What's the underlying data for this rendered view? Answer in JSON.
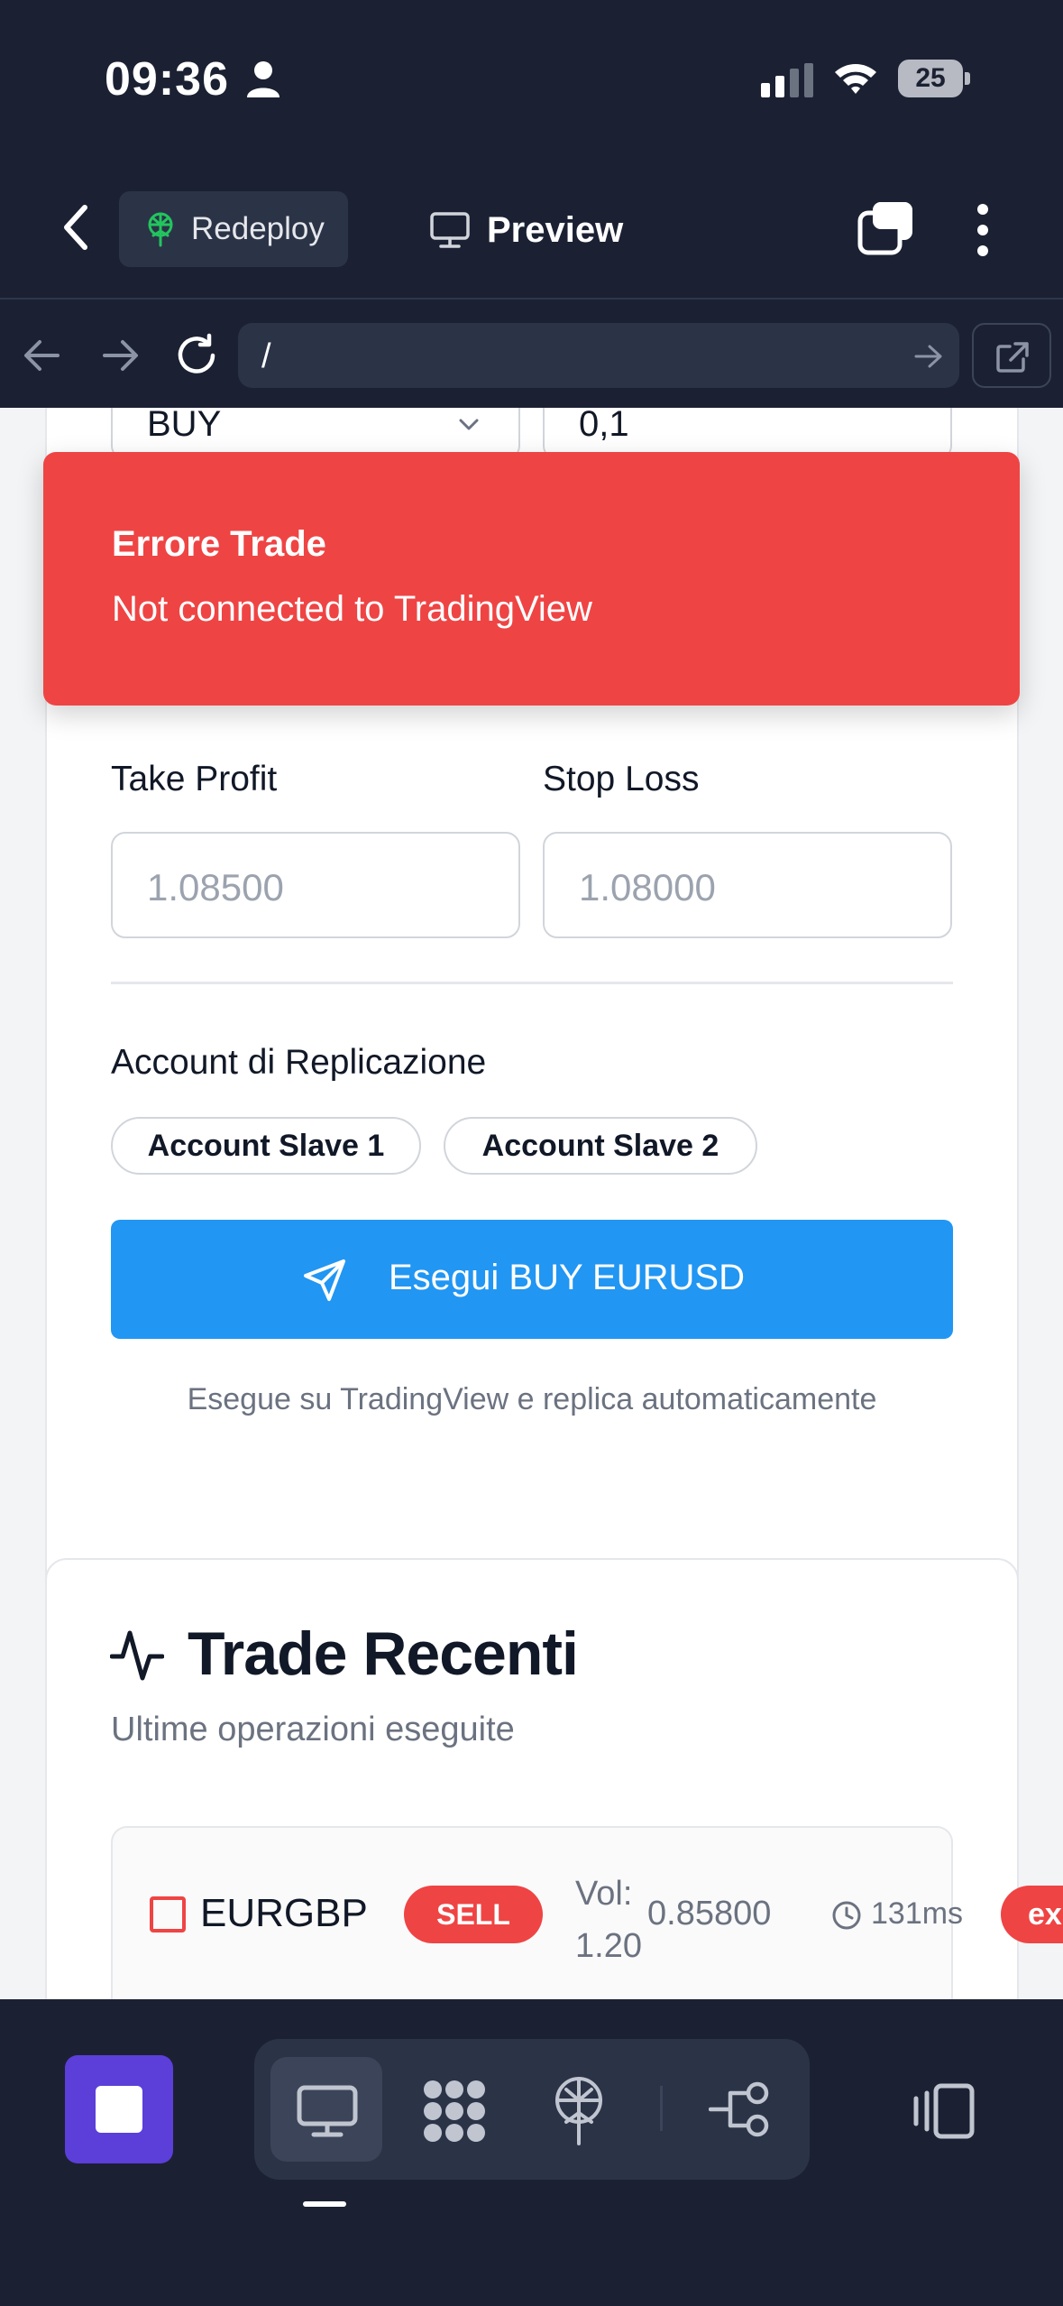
{
  "status_bar": {
    "time": "09:36",
    "battery": "25"
  },
  "header": {
    "redeploy_label": "Redeploy",
    "preview_label": "Preview"
  },
  "browser": {
    "url": "/"
  },
  "order_form": {
    "side_value": "BUY",
    "volume_value": "0,1",
    "take_profit_label": "Take Profit",
    "take_profit_placeholder": "1.08500",
    "stop_loss_label": "Stop Loss",
    "stop_loss_placeholder": "1.08000",
    "replication_label": "Account di Replicazione",
    "accounts": [
      "Account Slave 1",
      "Account Slave 2"
    ],
    "execute_label": "Esegui BUY EURUSD",
    "execute_hint": "Esegue su TradingView e replica automaticamente"
  },
  "toast": {
    "title": "Errore Trade",
    "message": "Not connected to TradingView"
  },
  "recent_trades": {
    "title": "Trade Recenti",
    "subtitle": "Ultime operazioni eseguite",
    "rows": [
      {
        "symbol": "EURGBP",
        "side": "SELL",
        "volume": "Vol: 1.20",
        "price": "0.85800",
        "latency": "131ms",
        "status": "ex"
      }
    ]
  },
  "colors": {
    "error": "#ef4444",
    "primary": "#2196f3",
    "chrome": "#1b2133",
    "stop": "#5b3fd8"
  }
}
